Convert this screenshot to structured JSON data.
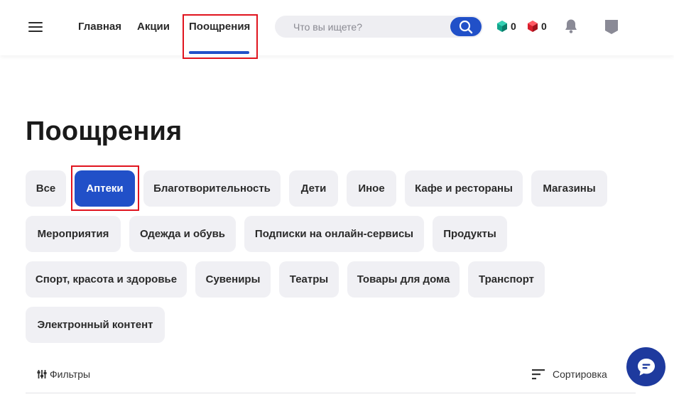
{
  "header": {
    "nav": {
      "main": "Главная",
      "promo": "Акции",
      "rewards": "Поощрения"
    },
    "search": {
      "placeholder": "Что вы ищете?"
    },
    "gems": {
      "green_count": "0",
      "red_count": "0"
    }
  },
  "page": {
    "title": "Поощрения"
  },
  "categories": [
    "Все",
    "Аптеки",
    "Благотворительность",
    "Дети",
    "Иное",
    "Кафе и рестораны",
    "Магазины",
    "Мероприятия",
    "Одежда и обувь",
    "Подписки на онлайн-сервисы",
    "Продукты",
    "Спорт, красота и здоровье",
    "Сувениры",
    "Театры",
    "Товары для дома",
    "Транспорт",
    "Электронный контент"
  ],
  "selected_category": "Аптеки",
  "toolbar": {
    "filters_label": "Фильтры",
    "sort_label": "Сортировка"
  },
  "colors": {
    "accent": "#2150c8",
    "highlight": "#e0141e"
  }
}
